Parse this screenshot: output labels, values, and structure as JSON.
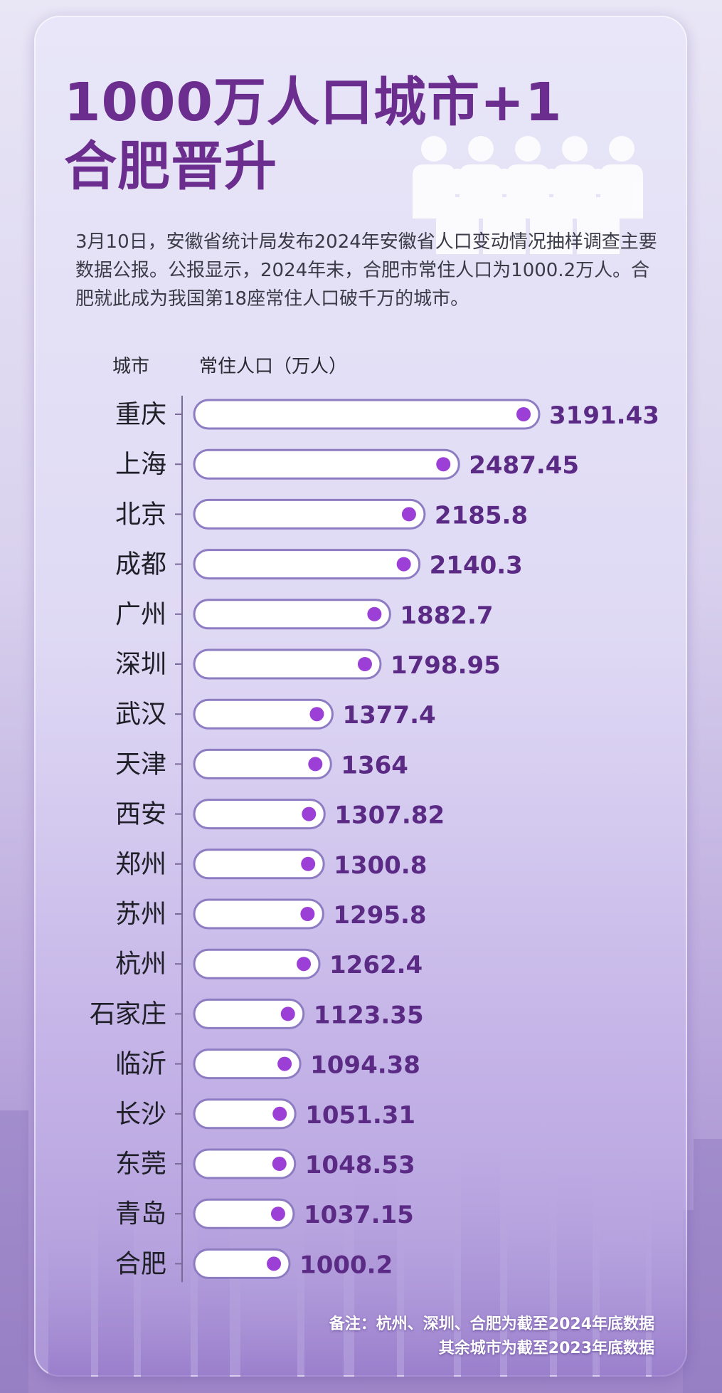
{
  "title": {
    "line1": "1000万人口城市+1",
    "line2": "合肥晋升"
  },
  "intro": "3月10日，安徽省统计局发布2024年安徽省人口变动情况抽样调查主要数据公报。公报显示，2024年末，合肥市常住人口为1000.2万人。合肥就此成为我国第18座常住人口破千万的城市。",
  "colors": {
    "title": "#6b2e8f",
    "value": "#5a2a84",
    "dot": "#9b3fd6",
    "bar_border": "#8e7cc3"
  },
  "chart_data": {
    "type": "bar",
    "orientation": "horizontal",
    "xlabel": "城市",
    "ylabel": "常住人口（万人）",
    "categories": [
      "重庆",
      "上海",
      "北京",
      "成都",
      "广州",
      "深圳",
      "武汉",
      "天津",
      "西安",
      "郑州",
      "苏州",
      "杭州",
      "石家庄",
      "临沂",
      "长沙",
      "东莞",
      "青岛",
      "合肥"
    ],
    "values": [
      3191.43,
      2487.45,
      2185.8,
      2140.3,
      1882.7,
      1798.95,
      1377.4,
      1364,
      1307.82,
      1300.8,
      1295.8,
      1262.4,
      1123.35,
      1094.38,
      1051.31,
      1048.53,
      1037.15,
      1000.2
    ],
    "value_labels": [
      "3191.43",
      "2487.45",
      "2185.8",
      "2140.3",
      "1882.7",
      "1798.95",
      "1377.4",
      "1364",
      "1307.82",
      "1300.8",
      "1295.8",
      "1262.4",
      "1123.35",
      "1094.38",
      "1051.31",
      "1048.53",
      "1037.15",
      "1000.2"
    ],
    "grid": false,
    "legend": "none"
  },
  "notes": {
    "line1": "备注：杭州、深圳、合肥为截至2024年底数据",
    "line2": "其余城市为截至2023年底数据"
  }
}
